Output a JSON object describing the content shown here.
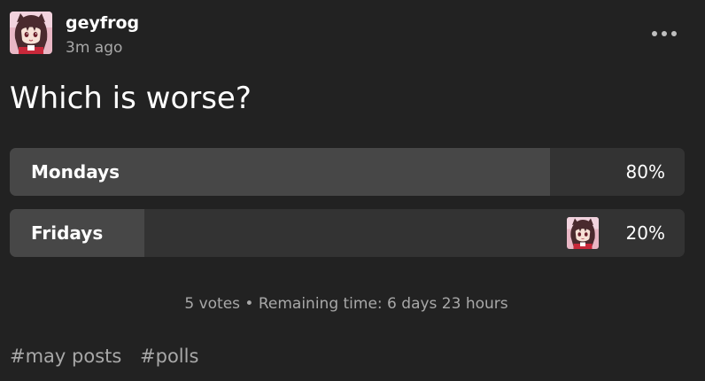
{
  "post": {
    "author": "geyfrog",
    "time": "3m ago",
    "question": "Which is worse?"
  },
  "poll": {
    "options": [
      {
        "label": "Mondays",
        "percent_text": "80%",
        "fraction": 0.8
      },
      {
        "label": "Fridays",
        "percent_text": "20%",
        "fraction": 0.2
      }
    ],
    "meta": "5 votes • Remaining time: 6 days 23 hours"
  },
  "tags": [
    "#may posts",
    "#polls"
  ],
  "icons": {
    "avatar": "avatar-image",
    "more": "more-options-icon",
    "voter": "voter-avatar-image"
  },
  "colors": {
    "background": "#222222",
    "option_track": "#333333",
    "option_fill": "#474747",
    "muted_text": "#a8a8a8"
  }
}
